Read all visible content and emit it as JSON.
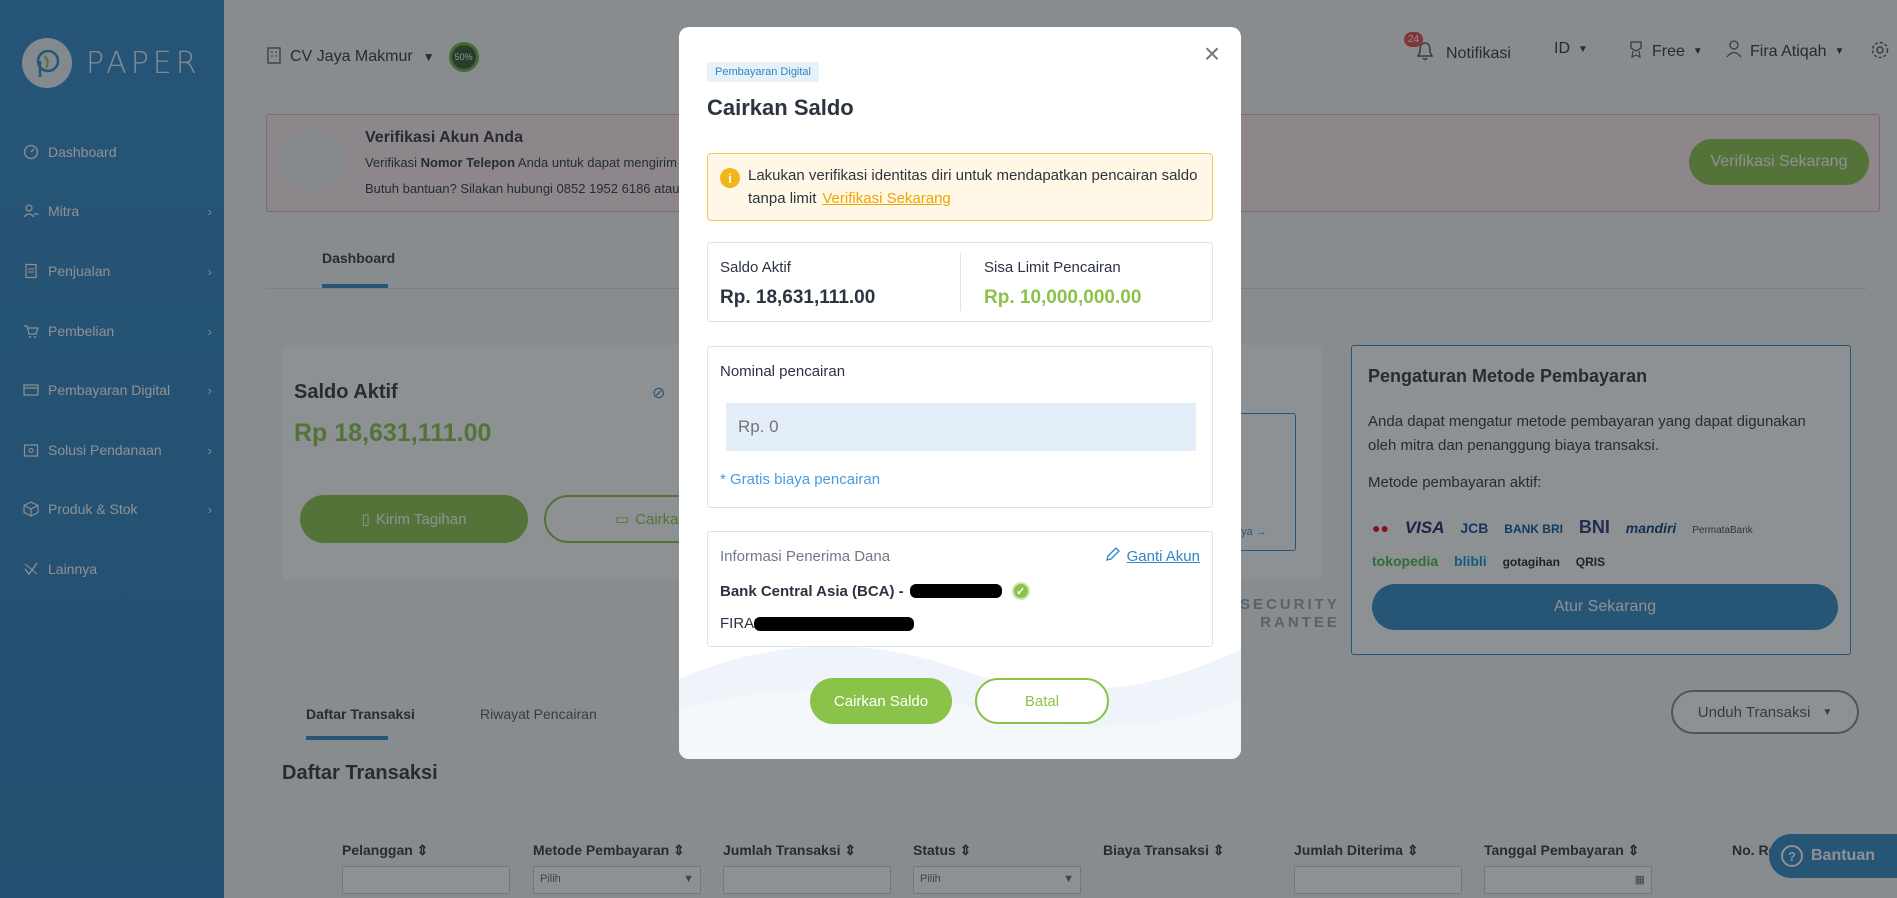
{
  "sidebar": {
    "brand": "PAPER",
    "items": [
      {
        "label": "Dashboard",
        "icon": "dashboard-icon",
        "chevron": false
      },
      {
        "label": "Mitra",
        "icon": "users-icon",
        "chevron": true
      },
      {
        "label": "Penjualan",
        "icon": "document-icon",
        "chevron": true
      },
      {
        "label": "Pembelian",
        "icon": "cart-icon",
        "chevron": true
      },
      {
        "label": "Pembayaran Digital",
        "icon": "card-icon",
        "chevron": true
      },
      {
        "label": "Solusi Pendanaan",
        "icon": "funding-icon",
        "chevron": true
      },
      {
        "label": "Produk & Stok",
        "icon": "box-icon",
        "chevron": true
      },
      {
        "label": "Lainnya",
        "icon": "more-icon",
        "chevron": false
      }
    ]
  },
  "header": {
    "company": "CV Jaya Makmur",
    "progress_badge": "50%",
    "notif_count": "24",
    "notif_label": "Notifikasi",
    "lang": "ID",
    "plan": "Free",
    "user": "Fira Atiqah"
  },
  "banner": {
    "title": "Verifikasi Akun Anda",
    "line1_prefix": "Verifikasi ",
    "line1_bold": "Nomor Telepon",
    "line1_suffix": " Anda untuk dapat mengirim",
    "line2": "Butuh bantuan? Silakan hubungi 0852 1952 6186 atau",
    "button": "Verifikasi Sekarang"
  },
  "tabs": {
    "dashboard": "Dashboard"
  },
  "saldo_card": {
    "label": "Saldo Aktif",
    "value": "Rp 18,631,111.00",
    "kirim": "Kirim Tagihan",
    "cairkan": "Cairkan S",
    "security_line1": "SECURITY",
    "security_line2": "RANTEE",
    "link": "nya"
  },
  "pengaturan": {
    "title": "Pengaturan Metode Pembayaran",
    "desc": "Anda dapat mengatur metode pembayaran yang dapat digunakan oleh mitra dan penanggung biaya transaksi.",
    "aktif": "Metode pembayaran aktif:",
    "logos": [
      "VISA",
      "JCB",
      "BANK BRI",
      "BNI",
      "mandiri",
      "PermataBank",
      "tokopedia",
      "blibli",
      "gotagihan",
      "QRIS"
    ],
    "button": "Atur Sekarang"
  },
  "transaksi": {
    "tab1": "Daftar Transaksi",
    "tab2": "Riwayat Pencairan",
    "unduh": "Unduh Transaksi",
    "title": "Daftar Transaksi",
    "columns": [
      "Pelanggan",
      "Metode Pembayaran",
      "Jumlah Transaksi",
      "Status",
      "Biaya Transaksi",
      "Jumlah Diterima",
      "Tanggal Pembayaran",
      "No. Re"
    ],
    "select_placeholder": "Pilih",
    "help": "Bantuan"
  },
  "modal": {
    "tag": "Pembayaran Digital",
    "title": "Cairkan Saldo",
    "alert_text": "Lakukan verifikasi identitas diri untuk mendapatkan pencairan saldo tanpa limit",
    "alert_link": "Verifikasi Sekarang",
    "saldo_label": "Saldo Aktif",
    "saldo_value": "Rp. 18,631,111.00",
    "limit_label": "Sisa Limit Pencairan",
    "limit_value": "Rp. 10,000,000.00",
    "nominal_label": "Nominal pencairan",
    "nominal_placeholder": "Rp. 0",
    "nominal_note": "* Gratis biaya pencairan",
    "info_label": "Informasi Penerima Dana",
    "ganti": "Ganti Akun",
    "bank": "Bank Central Asia (BCA) -",
    "name_prefix": "FIRA",
    "submit": "Cairkan Saldo",
    "cancel": "Batal"
  },
  "colors": {
    "primary": "#2f86c5",
    "accent_green": "#8bc34a",
    "warning": "#f2b51c"
  }
}
